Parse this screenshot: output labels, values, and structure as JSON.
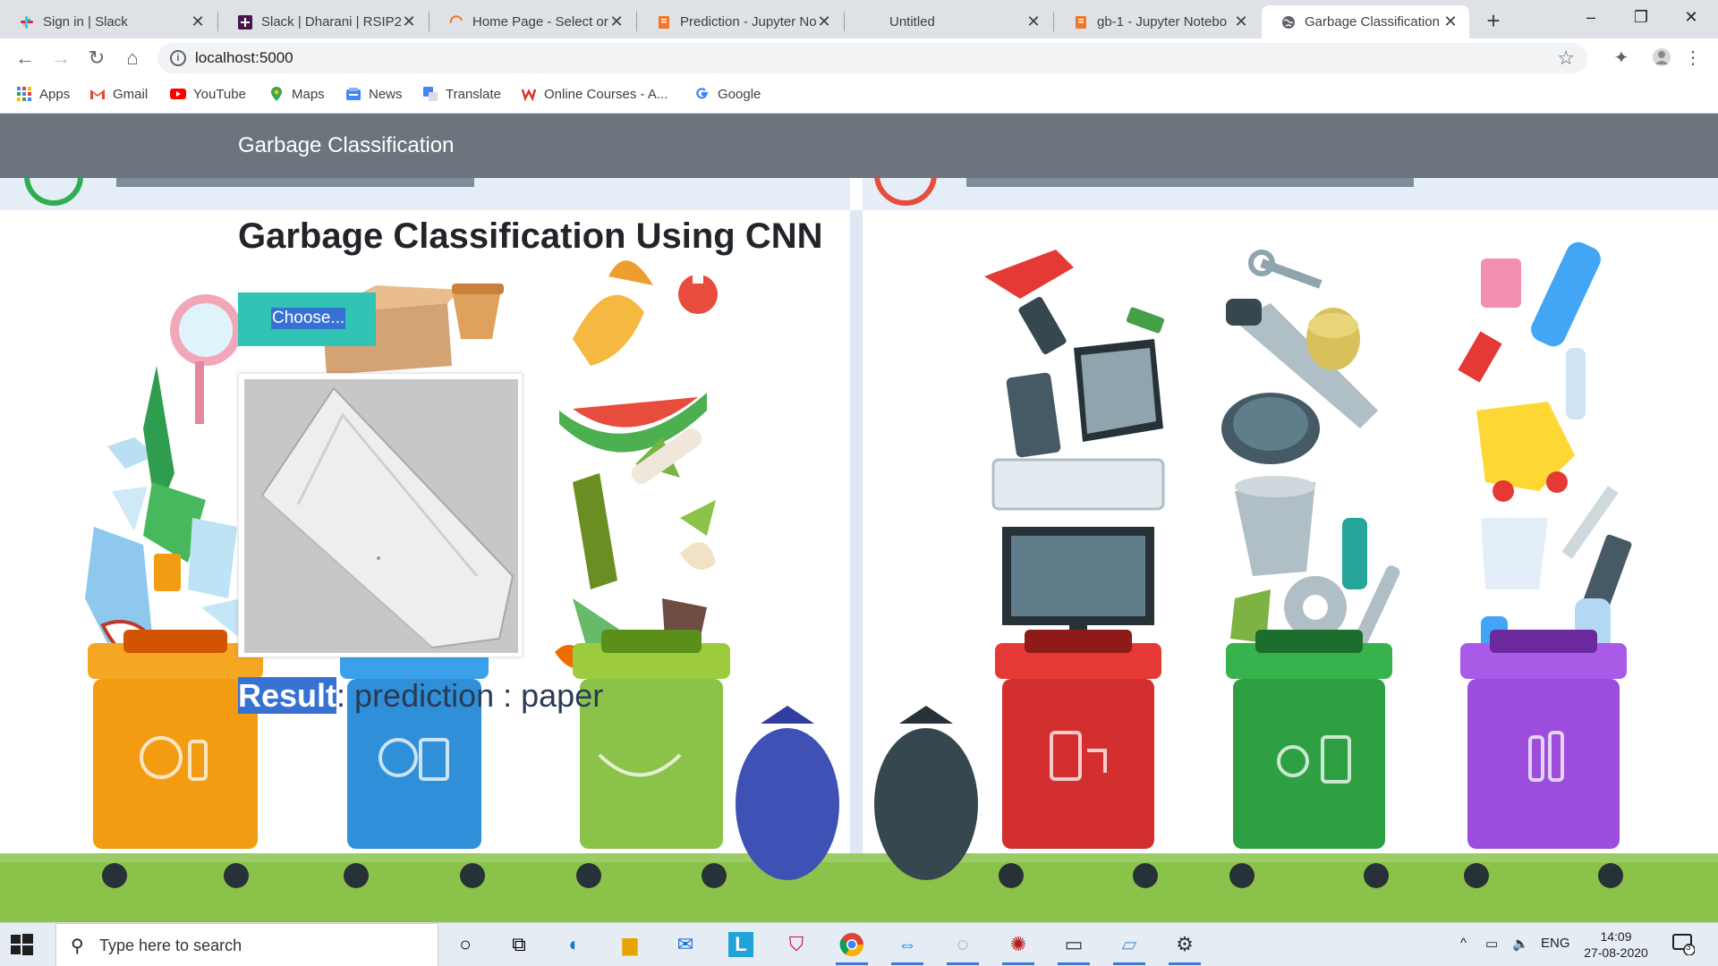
{
  "browser": {
    "tabs": [
      {
        "label": "Sign in | Slack",
        "icon": "slack-icon",
        "active": false
      },
      {
        "label": "Slack | Dharani | RSIP20",
        "icon": "slack-workspace-icon",
        "active": false
      },
      {
        "label": "Home Page - Select or",
        "icon": "jupyter-spinner-icon",
        "active": false
      },
      {
        "label": "Prediction - Jupyter No",
        "icon": "jupyter-notebook-icon",
        "active": false
      },
      {
        "label": "Untitled",
        "icon": "",
        "active": false
      },
      {
        "label": "gb-1 - Jupyter Notebo",
        "icon": "jupyter-notebook-icon",
        "active": false
      },
      {
        "label": "Garbage Classification",
        "icon": "globe-icon",
        "active": true
      }
    ],
    "url": "localhost:5000",
    "bookmarks": [
      {
        "label": "Apps",
        "icon": "apps-grid-icon"
      },
      {
        "label": "Gmail",
        "icon": "gmail-icon"
      },
      {
        "label": "YouTube",
        "icon": "youtube-icon"
      },
      {
        "label": "Maps",
        "icon": "maps-icon"
      },
      {
        "label": "News",
        "icon": "news-icon"
      },
      {
        "label": "Translate",
        "icon": "translate-icon"
      },
      {
        "label": "Online Courses - A...",
        "icon": "online-courses-icon"
      },
      {
        "label": "Google",
        "icon": "google-icon"
      }
    ]
  },
  "app": {
    "brand": "Garbage Classification",
    "heading": "Garbage Classification Using CNN",
    "choose_label": "Choose...",
    "result_label": "Result",
    "result_text": ": prediction : paper"
  },
  "taskbar": {
    "search_placeholder": "Type here to search",
    "language": "ENG",
    "time": "14:09",
    "date": "27-08-2020",
    "notifications": "3"
  },
  "colors": {
    "navbar": "#6c757d",
    "choose_button": "#31c3b3",
    "selection_highlight": "#3771d3"
  }
}
